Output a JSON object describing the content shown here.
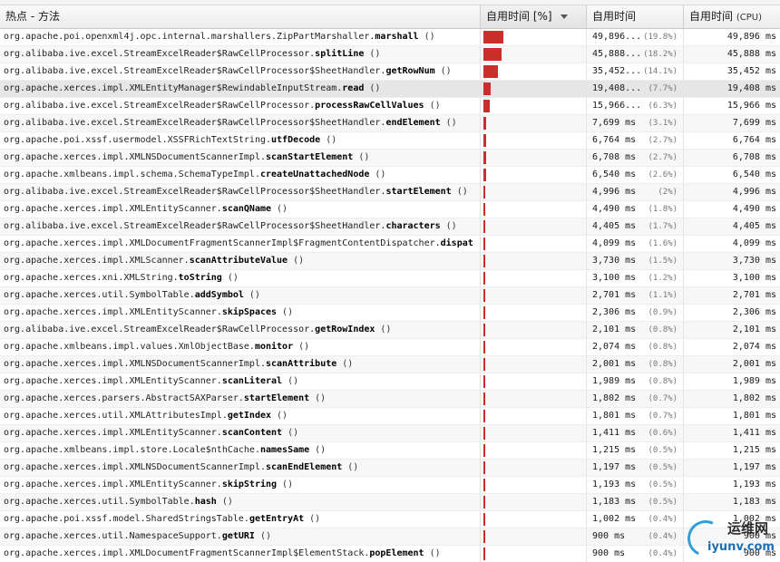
{
  "header": {
    "col_method": "热点 - 方法",
    "col_pct": "自用时间 [%]",
    "col_self": "自用时间",
    "col_cpu": "自用时间",
    "col_cpu_paren": "(CPU)"
  },
  "watermark": {
    "cn": "运维网",
    "url": "iyunv.com"
  },
  "colors": {
    "bar": "#c9302c",
    "header_bg": "#ececec",
    "row_alt": "#f7f7f7"
  },
  "rows": [
    {
      "pkg": "org.apache.poi.openxml4j.opc.internal.marshallers.ZipPartMarshaller.",
      "method": "marshall",
      "args": "()",
      "self": "49,896...",
      "pct": "(19.8%)",
      "cpu": "49,896 ms",
      "ratio": 0.198
    },
    {
      "pkg": "org.alibaba.ive.excel.StreamExcelReader$RawCellProcessor.",
      "method": "splitLine",
      "args": "()",
      "self": "45,888...",
      "pct": "(18.2%)",
      "cpu": "45,888 ms",
      "ratio": 0.182
    },
    {
      "pkg": "org.alibaba.ive.excel.StreamExcelReader$RawCellProcessor$SheetHandler.",
      "method": "getRowNum",
      "args": "()",
      "self": "35,452...",
      "pct": "(14.1%)",
      "cpu": "35,452 ms",
      "ratio": 0.141
    },
    {
      "pkg": "org.apache.xerces.impl.XMLEntityManager$RewindableInputStream.",
      "method": "read",
      "args": "()",
      "self": "19,408...",
      "pct": "(7.7%)",
      "cpu": "19,408 ms",
      "ratio": 0.077
    },
    {
      "pkg": "org.alibaba.ive.excel.StreamExcelReader$RawCellProcessor.",
      "method": "processRawCellValues",
      "args": "()",
      "self": "15,966...",
      "pct": "(6.3%)",
      "cpu": "15,966 ms",
      "ratio": 0.063
    },
    {
      "pkg": "org.alibaba.ive.excel.StreamExcelReader$RawCellProcessor$SheetHandler.",
      "method": "endElement",
      "args": "()",
      "self": "7,699 ms",
      "pct": "(3.1%)",
      "cpu": "7,699 ms",
      "ratio": 0.031
    },
    {
      "pkg": "org.apache.poi.xssf.usermodel.XSSFRichTextString.",
      "method": "utfDecode",
      "args": "()",
      "self": "6,764 ms",
      "pct": "(2.7%)",
      "cpu": "6,764 ms",
      "ratio": 0.027
    },
    {
      "pkg": "org.apache.xerces.impl.XMLNSDocumentScannerImpl.",
      "method": "scanStartElement",
      "args": "()",
      "self": "6,708 ms",
      "pct": "(2.7%)",
      "cpu": "6,708 ms",
      "ratio": 0.027
    },
    {
      "pkg": "org.apache.xmlbeans.impl.schema.SchemaTypeImpl.",
      "method": "createUnattachedNode",
      "args": "()",
      "self": "6,540 ms",
      "pct": "(2.6%)",
      "cpu": "6,540 ms",
      "ratio": 0.026
    },
    {
      "pkg": "org.alibaba.ive.excel.StreamExcelReader$RawCellProcessor$SheetHandler.",
      "method": "startElement",
      "args": "()",
      "self": "4,996 ms",
      "pct": "(2%)",
      "cpu": "4,996 ms",
      "ratio": 0.02
    },
    {
      "pkg": "org.apache.xerces.impl.XMLEntityScanner.",
      "method": "scanQName",
      "args": "()",
      "self": "4,490 ms",
      "pct": "(1.8%)",
      "cpu": "4,490 ms",
      "ratio": 0.018
    },
    {
      "pkg": "org.alibaba.ive.excel.StreamExcelReader$RawCellProcessor$SheetHandler.",
      "method": "characters",
      "args": "()",
      "self": "4,405 ms",
      "pct": "(1.7%)",
      "cpu": "4,405 ms",
      "ratio": 0.017
    },
    {
      "pkg": "org.apache.xerces.impl.XMLDocumentFragmentScannerImpl$FragmentContentDispatcher.",
      "method": "dispat",
      "args": "",
      "self": "4,099 ms",
      "pct": "(1.6%)",
      "cpu": "4,099 ms",
      "ratio": 0.016
    },
    {
      "pkg": "org.apache.xerces.impl.XMLScanner.",
      "method": "scanAttributeValue",
      "args": "()",
      "self": "3,730 ms",
      "pct": "(1.5%)",
      "cpu": "3,730 ms",
      "ratio": 0.015
    },
    {
      "pkg": "org.apache.xerces.xni.XMLString.",
      "method": "toString",
      "args": "()",
      "self": "3,100 ms",
      "pct": "(1.2%)",
      "cpu": "3,100 ms",
      "ratio": 0.012
    },
    {
      "pkg": "org.apache.xerces.util.SymbolTable.",
      "method": "addSymbol",
      "args": "()",
      "self": "2,701 ms",
      "pct": "(1.1%)",
      "cpu": "2,701 ms",
      "ratio": 0.011
    },
    {
      "pkg": "org.apache.xerces.impl.XMLEntityScanner.",
      "method": "skipSpaces",
      "args": "()",
      "self": "2,306 ms",
      "pct": "(0.9%)",
      "cpu": "2,306 ms",
      "ratio": 0.009
    },
    {
      "pkg": "org.alibaba.ive.excel.StreamExcelReader$RawCellProcessor.",
      "method": "getRowIndex",
      "args": "()",
      "self": "2,101 ms",
      "pct": "(0.8%)",
      "cpu": "2,101 ms",
      "ratio": 0.008
    },
    {
      "pkg": "org.apache.xmlbeans.impl.values.XmlObjectBase.",
      "method": "monitor",
      "args": "()",
      "self": "2,074 ms",
      "pct": "(0.8%)",
      "cpu": "2,074 ms",
      "ratio": 0.008
    },
    {
      "pkg": "org.apache.xerces.impl.XMLNSDocumentScannerImpl.",
      "method": "scanAttribute",
      "args": "()",
      "self": "2,001 ms",
      "pct": "(0.8%)",
      "cpu": "2,001 ms",
      "ratio": 0.008
    },
    {
      "pkg": "org.apache.xerces.impl.XMLEntityScanner.",
      "method": "scanLiteral",
      "args": "()",
      "self": "1,989 ms",
      "pct": "(0.8%)",
      "cpu": "1,989 ms",
      "ratio": 0.008
    },
    {
      "pkg": "org.apache.xerces.parsers.AbstractSAXParser.",
      "method": "startElement",
      "args": "()",
      "self": "1,802 ms",
      "pct": "(0.7%)",
      "cpu": "1,802 ms",
      "ratio": 0.007
    },
    {
      "pkg": "org.apache.xerces.util.XMLAttributesImpl.",
      "method": "getIndex",
      "args": "()",
      "self": "1,801 ms",
      "pct": "(0.7%)",
      "cpu": "1,801 ms",
      "ratio": 0.007
    },
    {
      "pkg": "org.apache.xerces.impl.XMLEntityScanner.",
      "method": "scanContent",
      "args": "()",
      "self": "1,411 ms",
      "pct": "(0.6%)",
      "cpu": "1,411 ms",
      "ratio": 0.006
    },
    {
      "pkg": "org.apache.xmlbeans.impl.store.Locale$nthCache.",
      "method": "namesSame",
      "args": "()",
      "self": "1,215 ms",
      "pct": "(0.5%)",
      "cpu": "1,215 ms",
      "ratio": 0.005
    },
    {
      "pkg": "org.apache.xerces.impl.XMLNSDocumentScannerImpl.",
      "method": "scanEndElement",
      "args": "()",
      "self": "1,197 ms",
      "pct": "(0.5%)",
      "cpu": "1,197 ms",
      "ratio": 0.005
    },
    {
      "pkg": "org.apache.xerces.impl.XMLEntityScanner.",
      "method": "skipString",
      "args": "()",
      "self": "1,193 ms",
      "pct": "(0.5%)",
      "cpu": "1,193 ms",
      "ratio": 0.005
    },
    {
      "pkg": "org.apache.xerces.util.SymbolTable.",
      "method": "hash",
      "args": "()",
      "self": "1,183 ms",
      "pct": "(0.5%)",
      "cpu": "1,183 ms",
      "ratio": 0.005
    },
    {
      "pkg": "org.apache.poi.xssf.model.SharedStringsTable.",
      "method": "getEntryAt",
      "args": "()",
      "self": "1,002 ms",
      "pct": "(0.4%)",
      "cpu": "1,002 ms",
      "ratio": 0.004
    },
    {
      "pkg": "org.apache.xerces.util.NamespaceSupport.",
      "method": "getURI",
      "args": "()",
      "self": "900 ms",
      "pct": "(0.4%)",
      "cpu": "900 ms",
      "ratio": 0.004
    },
    {
      "pkg": "org.apache.xerces.impl.XMLDocumentFragmentScannerImpl$ElementStack.",
      "method": "popElement",
      "args": "()",
      "self": "900 ms",
      "pct": "(0.4%)",
      "cpu": "900 ms",
      "ratio": 0.004
    }
  ]
}
